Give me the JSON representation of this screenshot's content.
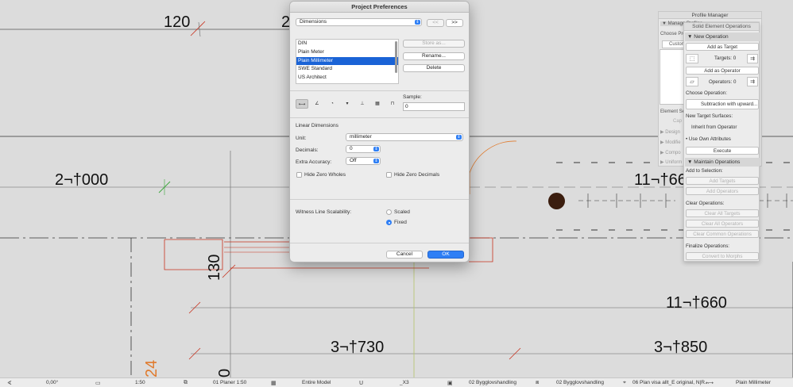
{
  "canvas": {
    "dims": [
      "120",
      "2",
      "2¬†000",
      "11¬†66",
      "130",
      "11¬†660",
      "3¬†730",
      "3¬†850",
      "24",
      "0"
    ]
  },
  "dialog": {
    "title": "Project Preferences",
    "category": "Dimensions",
    "prev_label": "<<",
    "next_label": ">>",
    "presets": [
      "DIN",
      "Plain Meter",
      "Plain Millimeter",
      "SWE Standard",
      "US Architect"
    ],
    "selected_preset": "Plain Millimeter",
    "store_as_label": "Store as...",
    "rename_label": "Rename...",
    "delete_label": "Delete",
    "sample_label": "Sample:",
    "sample_value": "0",
    "dimension_type_icons": [
      "linear-dimension-icon",
      "angle-dimension-icon",
      "radial-dimension-icon",
      "level-dimension-icon",
      "elevation-dimension-icon",
      "area-dimension-icon",
      "sill-height-dimension-icon"
    ],
    "linear_section": "Linear Dimensions",
    "unit_label": "Unit:",
    "unit_value": "millimeter",
    "decimals_label": "Decimals:",
    "decimals_value": "0",
    "extra_accuracy_label": "Extra Accuracy:",
    "extra_accuracy_value": "Off",
    "hide_zero_wholes": "Hide Zero Wholes",
    "hide_zero_decimals": "Hide Zero Decimals",
    "witness_label": "Witness Line Scalability:",
    "scaled_label": "Scaled",
    "fixed_label": "Fixed",
    "cancel_label": "Cancel",
    "ok_label": "OK"
  },
  "profile_manager": {
    "title": "Profile Manager",
    "manage_label": "Manage Profiles",
    "choose_label": "Choose Pro",
    "custom_label": "Custom",
    "element_label": "Element Sel",
    "cap_label": "Cap",
    "rows": [
      "Design",
      "Modifie",
      "Compo",
      "Uniform"
    ]
  },
  "seo": {
    "title": "Solid Element Operations",
    "new_operation": "New Operation",
    "add_as_target": "Add as Target",
    "targets_label": "Targets: 0",
    "add_as_operator": "Add as Operator",
    "operators_label": "Operators: 0",
    "choose_operation": "Choose Operation:",
    "operation_value": "Subtraction with upward...",
    "new_target_surfaces": "New Target Surfaces:",
    "inherit": "Inherit from Operator",
    "use_own": "Use Own Attributes",
    "execute": "Execute",
    "maintain": "Maintain Operations",
    "add_to_selection": "Add to Selection:",
    "add_targets": "Add Targets",
    "add_operators": "Add Operators",
    "clear_operations": "Clear Operations:",
    "clear_all_targets": "Clear All Targets",
    "clear_all_operators": "Clear All Operators",
    "clear_common": "Clear Common Operations",
    "finalize": "Finalize Operations:",
    "convert": "Convert to Morphs"
  },
  "status": {
    "angle": "0,00°",
    "scale": "1:50",
    "story": "01 Planer 1:50",
    "model": "Entire Model",
    "layer": "_X3",
    "renovation": "02 Bygglovshandling",
    "renovation2": "02 Bygglovshandling",
    "view": "06 Plan visa allt_E original, N|R...",
    "dimension": "Plain Millimeter"
  },
  "colors": {
    "accent": "#2f7ff5",
    "selection": "#1a63d6",
    "cad_red": "#c8311d",
    "cad_orange": "#e07a2c"
  }
}
